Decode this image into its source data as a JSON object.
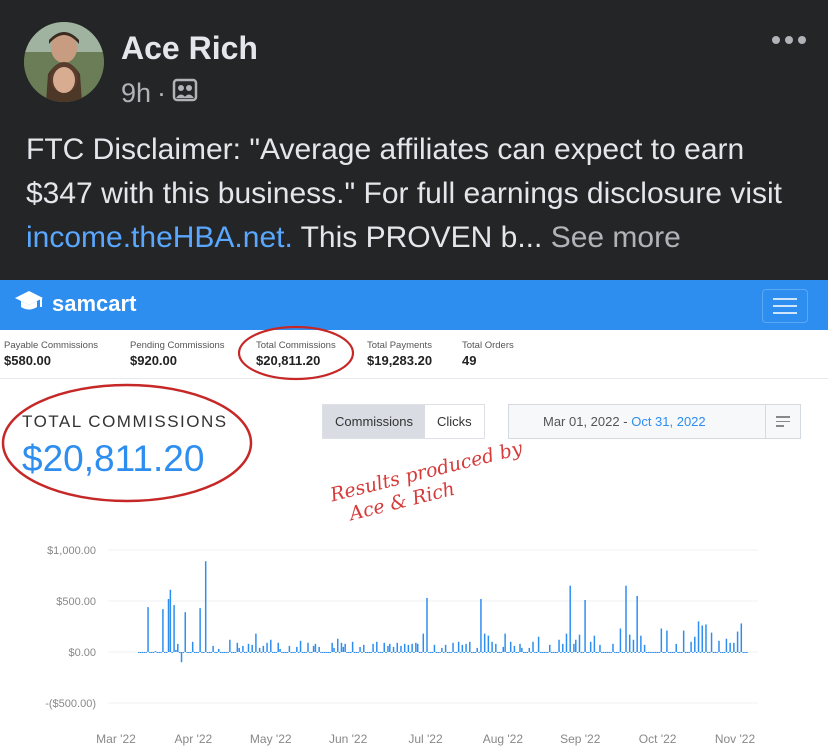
{
  "post": {
    "author": "Ace Rich",
    "time": "9h",
    "separator": "·",
    "text_main": "FTC Disclaimer: \"Average affiliates can expect to earn $347 with this business.\" For full earnings disclosure visit ",
    "link": "income.theHBA.net.",
    "text_after": " This PROVEN b...",
    "see_more": "See more"
  },
  "samcart": {
    "brand": "samcart",
    "stats": [
      {
        "label": "Payable Commissions",
        "value": "$580.00"
      },
      {
        "label": "Pending Commissions",
        "value": "$920.00"
      },
      {
        "label": "Total Commissions",
        "value": "$20,811.20"
      },
      {
        "label": "Total Payments",
        "value": "$19,283.20"
      },
      {
        "label": "Total Orders",
        "value": "49"
      }
    ],
    "total_label": "TOTAL COMMISSIONS",
    "total_value": "$20,811.20",
    "toggle": {
      "commissions": "Commissions",
      "clicks": "Clicks"
    },
    "date_from": "Mar 01, 2022",
    "date_sep": "-",
    "date_to": "Oct 31, 2022",
    "annotation_line1": "Results produced by",
    "annotation_line2": "Ace & Rich",
    "accent": "#2d8ef0",
    "annotation_color": "#d63b3b"
  },
  "chart_data": {
    "type": "bar",
    "ylim": [
      -500,
      1000
    ],
    "y_ticks": [
      "$1,000.00",
      "$500.00",
      "$0.00",
      "-($500.00)"
    ],
    "y_tick_values": [
      1000,
      500,
      0,
      -500
    ],
    "x_ticks": [
      "Mar '22",
      "Apr '22",
      "May '22",
      "Jun '22",
      "Jul '22",
      "Aug '22",
      "Sep '22",
      "Oct '22",
      "Nov '22"
    ],
    "values": [
      0,
      0,
      0,
      0,
      0,
      440,
      0,
      0,
      0,
      10,
      0,
      0,
      0,
      420,
      0,
      0,
      520,
      610,
      0,
      460,
      20,
      80,
      0,
      -100,
      0,
      390,
      0,
      0,
      0,
      100,
      0,
      0,
      0,
      430,
      0,
      0,
      890,
      0,
      0,
      0,
      60,
      0,
      0,
      30,
      0,
      0,
      0,
      0,
      0,
      120,
      0,
      0,
      0,
      90,
      40,
      0,
      60,
      0,
      0,
      80,
      0,
      70,
      0,
      180,
      0,
      40,
      0,
      60,
      0,
      90,
      0,
      120,
      0,
      0,
      0,
      90,
      30,
      0,
      0,
      0,
      0,
      60,
      0,
      0,
      0,
      50,
      0,
      110,
      0,
      0,
      0,
      90,
      0,
      0,
      60,
      80,
      0,
      50,
      0,
      0,
      0,
      0,
      0,
      0,
      90,
      40,
      0,
      130,
      0,
      90,
      50,
      80,
      0,
      0,
      0,
      100,
      0,
      0,
      0,
      50,
      0,
      70,
      0,
      0,
      0,
      0,
      80,
      0,
      100,
      0,
      0,
      0,
      90,
      0,
      60,
      80,
      0,
      50,
      0,
      90,
      0,
      60,
      0,
      80,
      0,
      70,
      0,
      80,
      0,
      90,
      80,
      0,
      0,
      180,
      0,
      530,
      0,
      0,
      0,
      70,
      0,
      0,
      0,
      40,
      0,
      70,
      0,
      0,
      0,
      90,
      0,
      0,
      100,
      0,
      70,
      0,
      80,
      0,
      100,
      0,
      0,
      0,
      40,
      0,
      520,
      0,
      180,
      0,
      160,
      0,
      100,
      0,
      80,
      0,
      0,
      0,
      50,
      180,
      0,
      0,
      100,
      0,
      60,
      0,
      0,
      80,
      40,
      0,
      0,
      0,
      40,
      0,
      100,
      0,
      0,
      150,
      0,
      0,
      0,
      0,
      0,
      70,
      0,
      0,
      0,
      0,
      120,
      0,
      80,
      0,
      180,
      0,
      650,
      0,
      80,
      120,
      0,
      170,
      0,
      0,
      510,
      0,
      0,
      100,
      0,
      160,
      0,
      0,
      70,
      0,
      0,
      0,
      0,
      0,
      0,
      80,
      0,
      0,
      0,
      230,
      0,
      0,
      650,
      0,
      170,
      0,
      120,
      0,
      550,
      0,
      160,
      0,
      70,
      0,
      0,
      0,
      0,
      0,
      0,
      0,
      0,
      230,
      0,
      0,
      210,
      0,
      0,
      0,
      0,
      80,
      0,
      0,
      0,
      210,
      0,
      0,
      0,
      100,
      0,
      150,
      0,
      300,
      0,
      260,
      0,
      270,
      0,
      0,
      190,
      0,
      0,
      0,
      110,
      0,
      0,
      0,
      130,
      0,
      90,
      0,
      90,
      0,
      200,
      0,
      280,
      0,
      0,
      0
    ]
  }
}
